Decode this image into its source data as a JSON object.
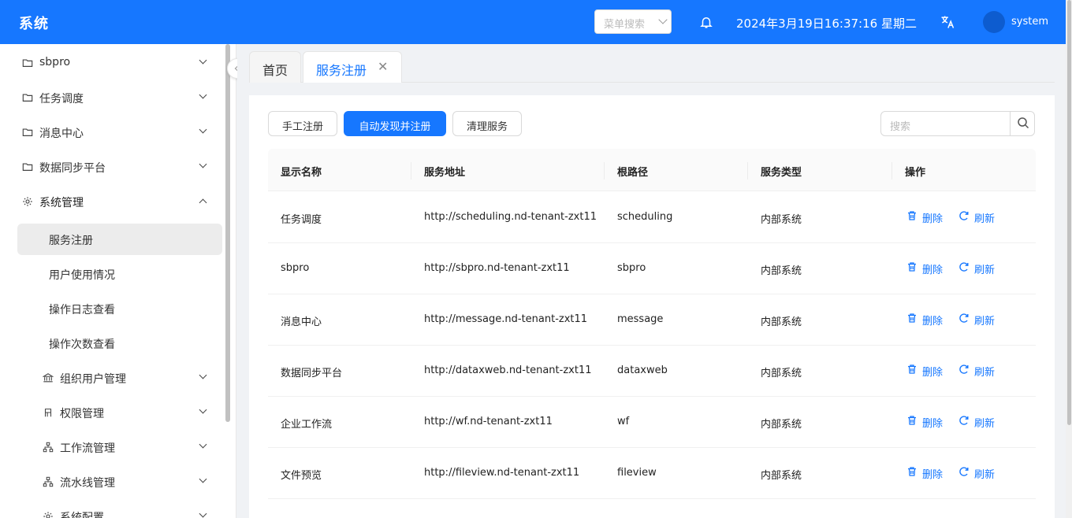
{
  "header": {
    "brand": "系统",
    "menu_search_placeholder": "菜单搜索",
    "datetime": "2024年3月19日16:37:16 星期二",
    "username": "system"
  },
  "sidebar": {
    "items": [
      {
        "label": "sbpro",
        "icon": "folder-icon"
      },
      {
        "label": "任务调度",
        "icon": "folder-icon"
      },
      {
        "label": "消息中心",
        "icon": "folder-icon"
      },
      {
        "label": "数据同步平台",
        "icon": "folder-icon"
      },
      {
        "label": "系统管理",
        "icon": "gear-icon"
      }
    ],
    "system_children": [
      "服务注册",
      "用户使用情况",
      "操作日志查看",
      "操作次数查看"
    ],
    "groups": [
      {
        "label": "组织用户管理",
        "icon": "bank-icon"
      },
      {
        "label": "权限管理",
        "icon": "permission-icon"
      },
      {
        "label": "工作流管理",
        "icon": "hierarchy-icon"
      },
      {
        "label": "流水线管理",
        "icon": "hierarchy-icon"
      },
      {
        "label": "系统配置",
        "icon": "gear-icon"
      }
    ]
  },
  "tabs": {
    "home": "首页",
    "current": "服务注册",
    "close_glyph": "✕"
  },
  "toolbar": {
    "manual_register": "手工注册",
    "auto_discover": "自动发现并注册",
    "clean_services": "清理服务",
    "search_placeholder": "搜索"
  },
  "table": {
    "columns": [
      "显示名称",
      "服务地址",
      "根路径",
      "服务类型",
      "操作"
    ],
    "delete_label": "删除",
    "refresh_label": "刷新",
    "rows": [
      {
        "name": "任务调度",
        "address": "http://scheduling.nd-tenant-zxt11",
        "root": "scheduling",
        "type": "内部系统"
      },
      {
        "name": "sbpro",
        "address": "http://sbpro.nd-tenant-zxt11",
        "root": "sbpro",
        "type": "内部系统"
      },
      {
        "name": "消息中心",
        "address": "http://message.nd-tenant-zxt11",
        "root": "message",
        "type": "内部系统"
      },
      {
        "name": "数据同步平台",
        "address": "http://dataxweb.nd-tenant-zxt11",
        "root": "dataxweb",
        "type": "内部系统"
      },
      {
        "name": "企业工作流",
        "address": "http://wf.nd-tenant-zxt11",
        "root": "wf",
        "type": "内部系统"
      },
      {
        "name": "文件预览",
        "address": "http://fileview.nd-tenant-zxt11",
        "root": "fileview",
        "type": "内部系统"
      }
    ]
  },
  "colors": {
    "primary": "#1677ff",
    "header_bg": "#1677ff",
    "selected_menu_bg": "#ececec"
  }
}
